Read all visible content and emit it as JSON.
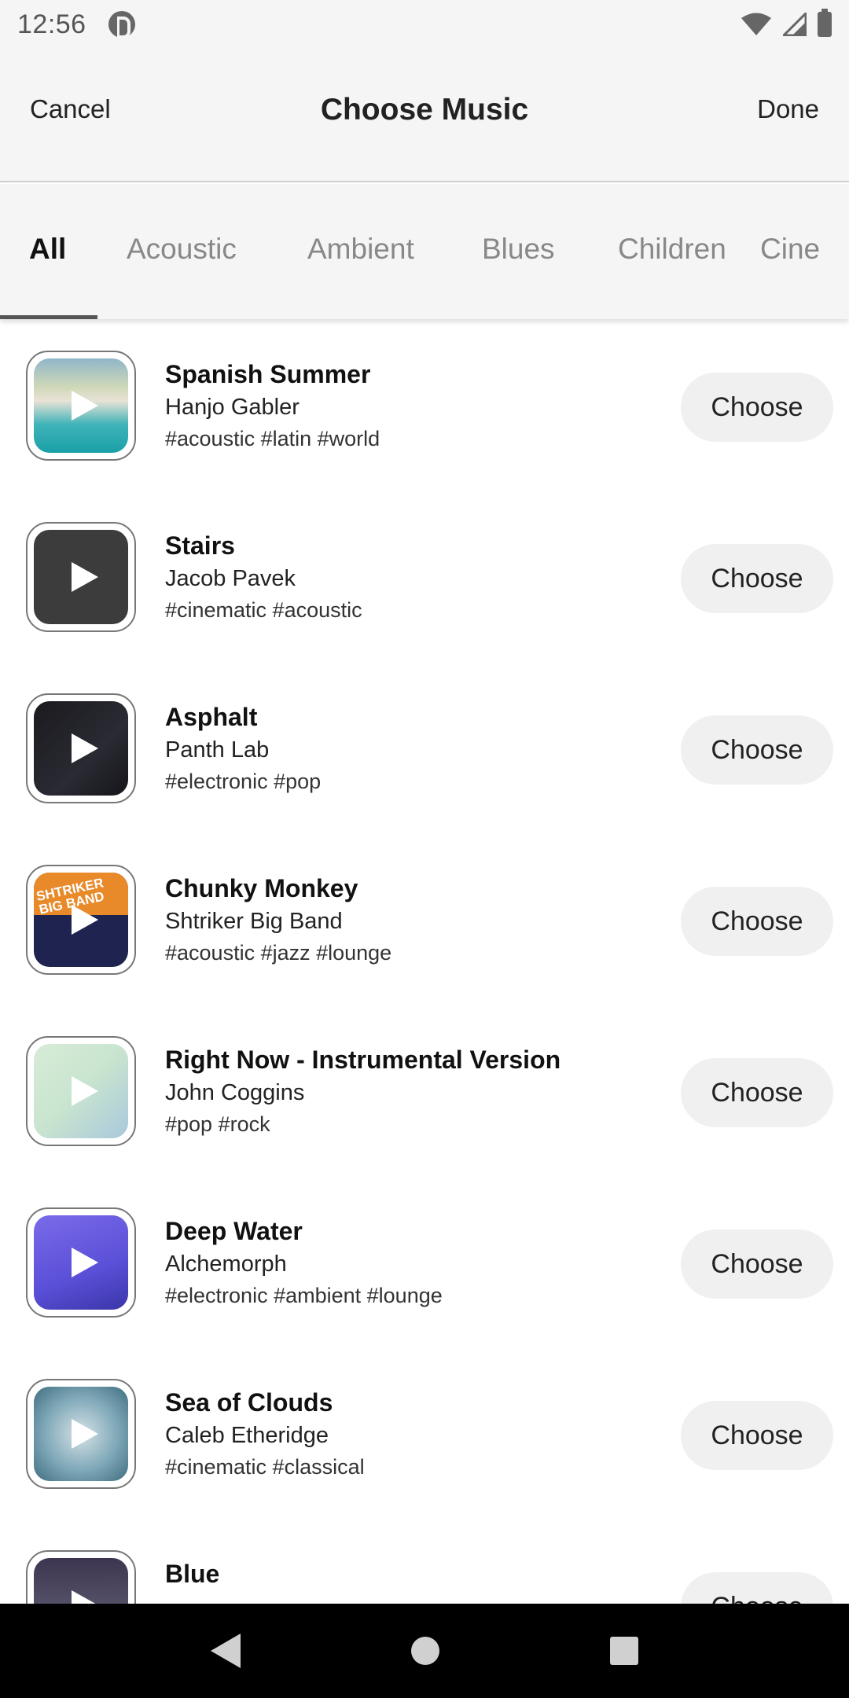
{
  "status_bar": {
    "time": "12:56",
    "icons": [
      "app-icon",
      "wifi-icon",
      "signal-icon",
      "battery-icon"
    ]
  },
  "header": {
    "cancel_label": "Cancel",
    "title": "Choose Music",
    "done_label": "Done"
  },
  "tabs": [
    {
      "label": "All",
      "active": true
    },
    {
      "label": "Acoustic",
      "active": false
    },
    {
      "label": "Ambient",
      "active": false
    },
    {
      "label": "Blues",
      "active": false
    },
    {
      "label": "Children",
      "active": false
    },
    {
      "label": "Cine",
      "active": false
    }
  ],
  "songs": [
    {
      "title": "Spanish Summer",
      "artist": "Hanjo Gabler",
      "tags": "#acoustic #latin #world",
      "button": "Choose"
    },
    {
      "title": "Stairs",
      "artist": "Jacob Pavek",
      "tags": "#cinematic #acoustic",
      "button": "Choose"
    },
    {
      "title": "Asphalt",
      "artist": "Panth Lab",
      "tags": "#electronic #pop",
      "button": "Choose"
    },
    {
      "title": "Chunky Monkey",
      "artist": "Shtriker Big Band",
      "tags": "#acoustic #jazz #lounge",
      "button": "Choose",
      "art_text": "SHTRIKER BIG BAND"
    },
    {
      "title": "Right Now - Instrumental Version",
      "artist": "John Coggins",
      "tags": "#pop #rock",
      "button": "Choose"
    },
    {
      "title": "Deep Water",
      "artist": "Alchemorph",
      "tags": "#electronic #ambient #lounge",
      "button": "Choose"
    },
    {
      "title": "Sea of Clouds",
      "artist": "Caleb Etheridge",
      "tags": "#cinematic #classical",
      "button": "Choose"
    },
    {
      "title": "Blue",
      "artist": "",
      "tags": "",
      "button": "Choose"
    }
  ],
  "nav": {
    "icons": [
      "back-icon",
      "home-icon",
      "recents-icon"
    ]
  }
}
